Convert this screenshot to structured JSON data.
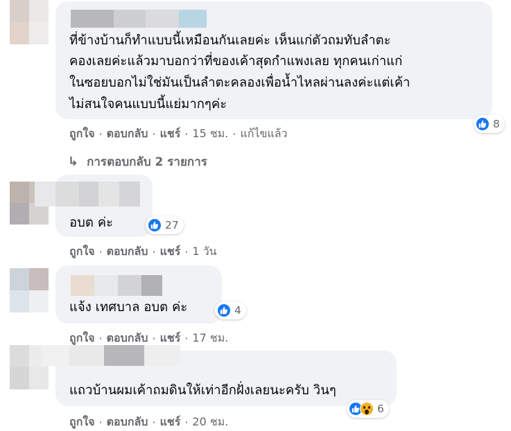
{
  "colors": {
    "bubble": "#f0f2f5",
    "like": "#1877f2",
    "wow": "#f7b125",
    "meta": "#65676b"
  },
  "icons": {
    "like": "like-icon",
    "wow": "wow-icon",
    "reply_arrow": "reply-arrow-icon"
  },
  "actions": {
    "like": "ถูกใจ",
    "reply": "ตอบกลับ",
    "share": "แชร์",
    "separator": "·"
  },
  "comments": [
    {
      "lines": [
        "ที่ข้างบ้านก็ทำแบบนี้เหมือนกันเลยค่ะ เห็นแก่ตัวถมทับลำตะ",
        "คองเลยค่ะแล้วมาบอกว่าที่ของเค้าสุดกำแพงเลย ทุกคนเก่าแก่",
        "ในซอยบอกไม่ใช่มันเป็นลำตะคลองเพื่อน้ำไหลผ่านลงค่ะแต่เค้า",
        "ไม่สนใจคนแบบนี้แย่มากๆค่ะ"
      ],
      "reaction_count": "8",
      "timestamp": "15 ชม.",
      "edited": "แก้ไขแล้ว",
      "replies_label": "การตอบกลับ 2 รายการ"
    },
    {
      "text": "อบต ค่ะ",
      "reaction_count": "27",
      "timestamp": "1 วัน"
    },
    {
      "text": "แจ้ง เทศบาล อบต ค่ะ",
      "reaction_count": "4",
      "timestamp": "17 ชม."
    },
    {
      "text": "แถวบ้านผมเค้าถมดินให้เท่าอีกฝั่งเลยนะครับ วินๆ",
      "reaction_count": "6",
      "timestamp": "20 ชม."
    }
  ]
}
